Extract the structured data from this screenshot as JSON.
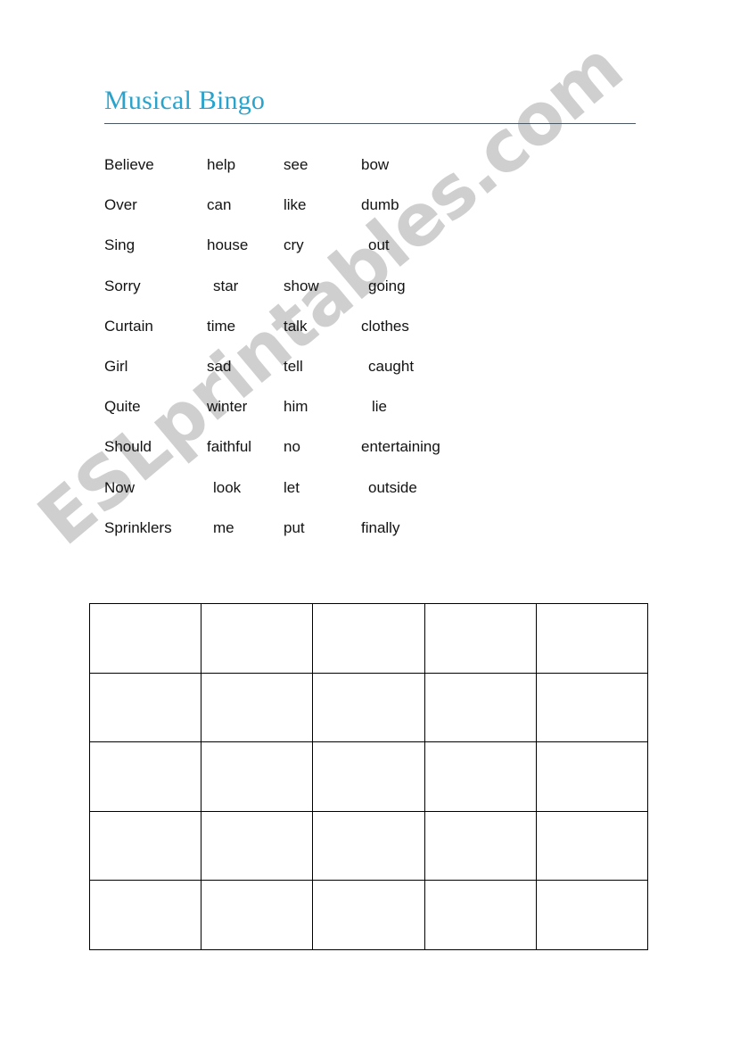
{
  "document": {
    "title": "Musical Bingo",
    "title_color": "#29a3cc",
    "rule_color": "#4a5864",
    "background": "#ffffff"
  },
  "watermark": {
    "text": "ESLprintables.com",
    "color": "#cfcfcf",
    "rotation_deg": -40
  },
  "word_list": {
    "columns": 4,
    "rows": [
      {
        "c0": "Believe",
        "c1": "help",
        "c2": "see",
        "c3": "bow"
      },
      {
        "c0": "Over",
        "c1": "can",
        "c2": "like",
        "c3": "dumb"
      },
      {
        "c0": "Sing",
        "c1": "house",
        "c2": "cry",
        "c3": "out"
      },
      {
        "c0": "Sorry",
        "c1": "star",
        "c2": "show",
        "c3": "going"
      },
      {
        "c0": "Curtain",
        "c1": "time",
        "c2": "talk",
        "c3": "clothes"
      },
      {
        "c0": "Girl",
        "c1": "sad",
        "c2": "tell",
        "c3": "caught"
      },
      {
        "c0": "Quite",
        "c1": "winter",
        "c2": "him",
        "c3": "lie"
      },
      {
        "c0": "Should",
        "c1": "faithful",
        "c2": "no",
        "c3": "entertaining"
      },
      {
        "c0": "Now",
        "c1": "look",
        "c2": "let",
        "c3": "outside"
      },
      {
        "c0": "Sprinklers",
        "c1": "me",
        "c2": "put",
        "c3": "finally"
      }
    ]
  },
  "bingo_grid": {
    "rows": 5,
    "cols": 5,
    "border_color": "#000000",
    "cells": [
      [
        "",
        "",
        "",
        "",
        ""
      ],
      [
        "",
        "",
        "",
        "",
        ""
      ],
      [
        "",
        "",
        "",
        "",
        ""
      ],
      [
        "",
        "",
        "",
        "",
        ""
      ],
      [
        "",
        "",
        "",
        "",
        ""
      ]
    ]
  }
}
